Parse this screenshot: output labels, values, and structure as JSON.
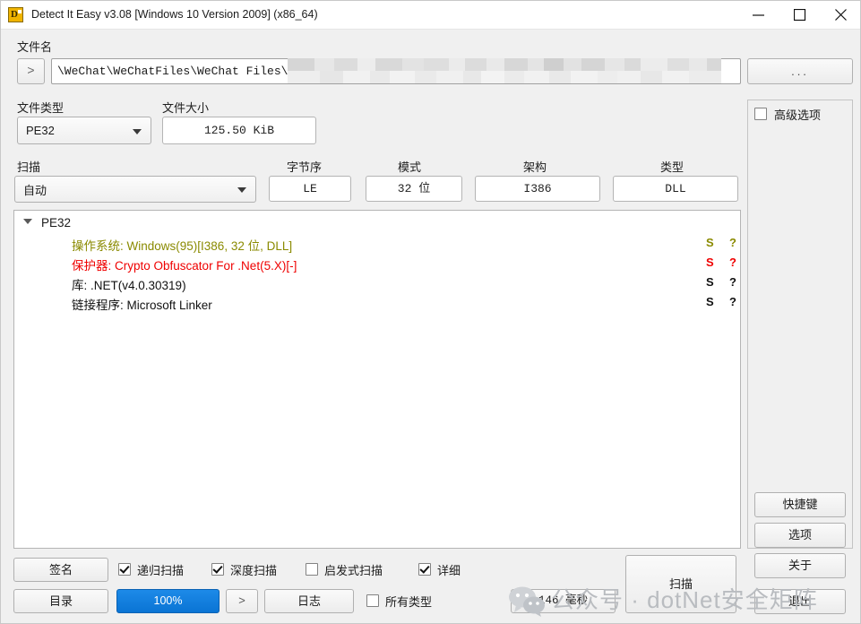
{
  "window": {
    "title": "Detect It Easy v3.08 [Windows 10 Version 2009] (x86_64)",
    "icon_name": "die-app-icon",
    "icon_glyph": "D",
    "minimize_label": "—",
    "maximize_label": "□",
    "close_label": "✕"
  },
  "filename_section": {
    "label": "文件名",
    "expand_button": ">",
    "path_value": "\\WeChat\\WeChatFiles\\WeChat Files\\",
    "browse_label": "..."
  },
  "filetype_section": {
    "label": "文件类型",
    "value": "PE32"
  },
  "filesize_section": {
    "label": "文件大小",
    "value": "125.50 KiB"
  },
  "scan_section": {
    "label": "扫描",
    "mode_value": "自动",
    "endianness": {
      "label": "字节序",
      "value": "LE"
    },
    "mode": {
      "label": "模式",
      "value": "32 位"
    },
    "architecture": {
      "label": "架构",
      "value": "I386"
    },
    "type": {
      "label": "类型",
      "value": "DLL"
    }
  },
  "results": {
    "root_label": "PE32",
    "flag_s": "S",
    "flag_q": "?",
    "rows": [
      {
        "key": "操作系统: ",
        "value": "Windows(95)[I386, 32 位, DLL]",
        "color": "#8a8a00"
      },
      {
        "key": "保护器: ",
        "value": "Crypto Obfuscator For .Net(5.X)[-]",
        "color": "#ef0000"
      },
      {
        "key": "库: ",
        "value": ".NET(v4.0.30319)",
        "color": "#111111"
      },
      {
        "key": "链接程序: ",
        "value": "Microsoft Linker",
        "color": "#111111"
      }
    ]
  },
  "side_panel": {
    "advanced_label": "高级选项",
    "advanced_checked": false,
    "buttons": [
      {
        "label": "快捷键"
      },
      {
        "label": "选项"
      },
      {
        "label": "关于"
      },
      {
        "label": "退出"
      }
    ]
  },
  "bottom_bar": {
    "signature_label": "签名",
    "directory_label": "目录",
    "progress_label": "100%",
    "next_label": ">",
    "log_label": "日志",
    "elapsed_label": "146 毫秒",
    "scan_label": "扫描",
    "checkboxes": [
      {
        "label": "递归扫描",
        "checked": true
      },
      {
        "label": "深度扫描",
        "checked": true
      },
      {
        "label": "启发式扫描",
        "checked": false
      },
      {
        "label": "详细",
        "checked": true
      }
    ],
    "all_types": {
      "label": "所有类型",
      "checked": false
    }
  },
  "watermark": {
    "text": "公众号 · dotNet安全矩阵",
    "logo_name": "wechat-logo"
  },
  "colors": {
    "accent": "#0a74d4",
    "warning": "#8a8a00",
    "danger": "#ef0000",
    "window_bg": "#f0f0f0"
  }
}
